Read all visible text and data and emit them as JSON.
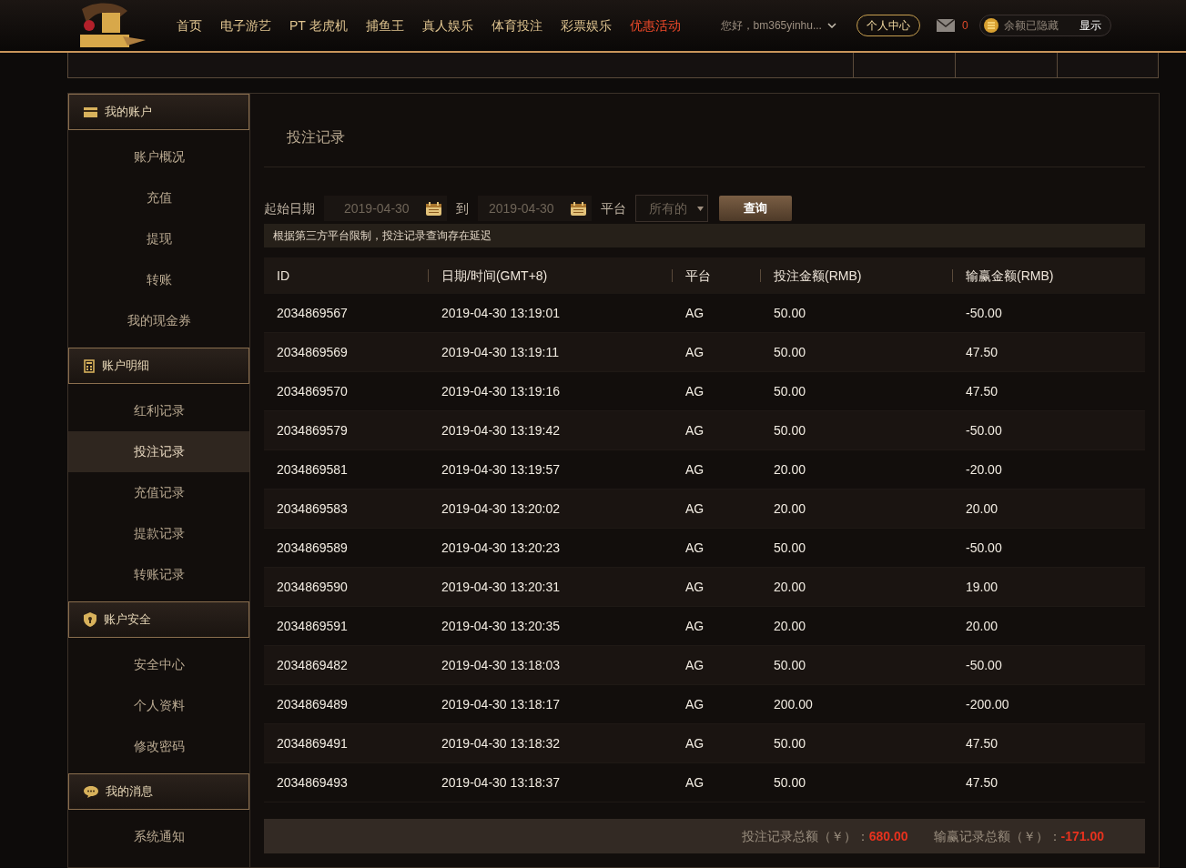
{
  "header": {
    "nav": [
      {
        "label": "首页",
        "hot": false
      },
      {
        "label": "电子游艺",
        "hot": false
      },
      {
        "label": "PT 老虎机",
        "hot": false
      },
      {
        "label": "捕鱼王",
        "hot": false
      },
      {
        "label": "真人娱乐",
        "hot": false
      },
      {
        "label": "体育投注",
        "hot": false
      },
      {
        "label": "彩票娱乐",
        "hot": false
      },
      {
        "label": "优惠活动",
        "hot": true
      }
    ],
    "greeting": "您好，bm365yinhu...",
    "personal_center": "个人中心",
    "mail_count": "0",
    "balance_text": "余额已隐藏",
    "show_button": "显示"
  },
  "sidebar": [
    {
      "title": "我的账户",
      "kind": "card",
      "items": [
        {
          "label": "账户概况",
          "selected": false
        },
        {
          "label": "充值",
          "selected": false
        },
        {
          "label": "提现",
          "selected": false
        },
        {
          "label": "转账",
          "selected": false
        },
        {
          "label": "我的现金券",
          "selected": false
        }
      ]
    },
    {
      "title": "账户明细",
      "kind": "calculator",
      "items": [
        {
          "label": "红利记录",
          "selected": false
        },
        {
          "label": "投注记录",
          "selected": true
        },
        {
          "label": "充值记录",
          "selected": false
        },
        {
          "label": "提款记录",
          "selected": false
        },
        {
          "label": "转账记录",
          "selected": false
        }
      ]
    },
    {
      "title": "账户安全",
      "kind": "shield",
      "items": [
        {
          "label": "安全中心",
          "selected": false
        },
        {
          "label": "个人资料",
          "selected": false
        },
        {
          "label": "修改密码",
          "selected": false
        }
      ]
    },
    {
      "title": "我的消息",
      "kind": "chat",
      "items": [
        {
          "label": "系统通知",
          "selected": false
        }
      ]
    }
  ],
  "main": {
    "title": "投注记录",
    "filter": {
      "start_label": "起始日期",
      "start_date": "2019-04-30",
      "to_label": "到",
      "end_date": "2019-04-30",
      "platform_label": "平台",
      "platform_value": "所有的",
      "query_button": "查询"
    },
    "notice": "根据第三方平台限制，投注记录查询存在延迟",
    "table": {
      "columns": [
        "ID",
        "日期/时间(GMT+8)",
        "平台",
        "投注金额(RMB)",
        "输赢金额(RMB)"
      ],
      "rows": [
        [
          "2034869567",
          "2019-04-30 13:19:01",
          "AG",
          "50.00",
          "-50.00"
        ],
        [
          "2034869569",
          "2019-04-30 13:19:11",
          "AG",
          "50.00",
          "47.50"
        ],
        [
          "2034869570",
          "2019-04-30 13:19:16",
          "AG",
          "50.00",
          "47.50"
        ],
        [
          "2034869579",
          "2019-04-30 13:19:42",
          "AG",
          "50.00",
          "-50.00"
        ],
        [
          "2034869581",
          "2019-04-30 13:19:57",
          "AG",
          "20.00",
          "-20.00"
        ],
        [
          "2034869583",
          "2019-04-30 13:20:02",
          "AG",
          "20.00",
          "20.00"
        ],
        [
          "2034869589",
          "2019-04-30 13:20:23",
          "AG",
          "50.00",
          "-50.00"
        ],
        [
          "2034869590",
          "2019-04-30 13:20:31",
          "AG",
          "20.00",
          "19.00"
        ],
        [
          "2034869591",
          "2019-04-30 13:20:35",
          "AG",
          "20.00",
          "20.00"
        ],
        [
          "2034869482",
          "2019-04-30 13:18:03",
          "AG",
          "50.00",
          "-50.00"
        ],
        [
          "2034869489",
          "2019-04-30 13:18:17",
          "AG",
          "200.00",
          "-200.00"
        ],
        [
          "2034869491",
          "2019-04-30 13:18:32",
          "AG",
          "50.00",
          "47.50"
        ],
        [
          "2034869493",
          "2019-04-30 13:18:37",
          "AG",
          "50.00",
          "47.50"
        ]
      ]
    },
    "totals": [
      {
        "label": "投注记录总额（￥）：",
        "value": "680.00"
      },
      {
        "label": "输赢记录总额（￥）：",
        "value": "-171.00"
      }
    ]
  }
}
